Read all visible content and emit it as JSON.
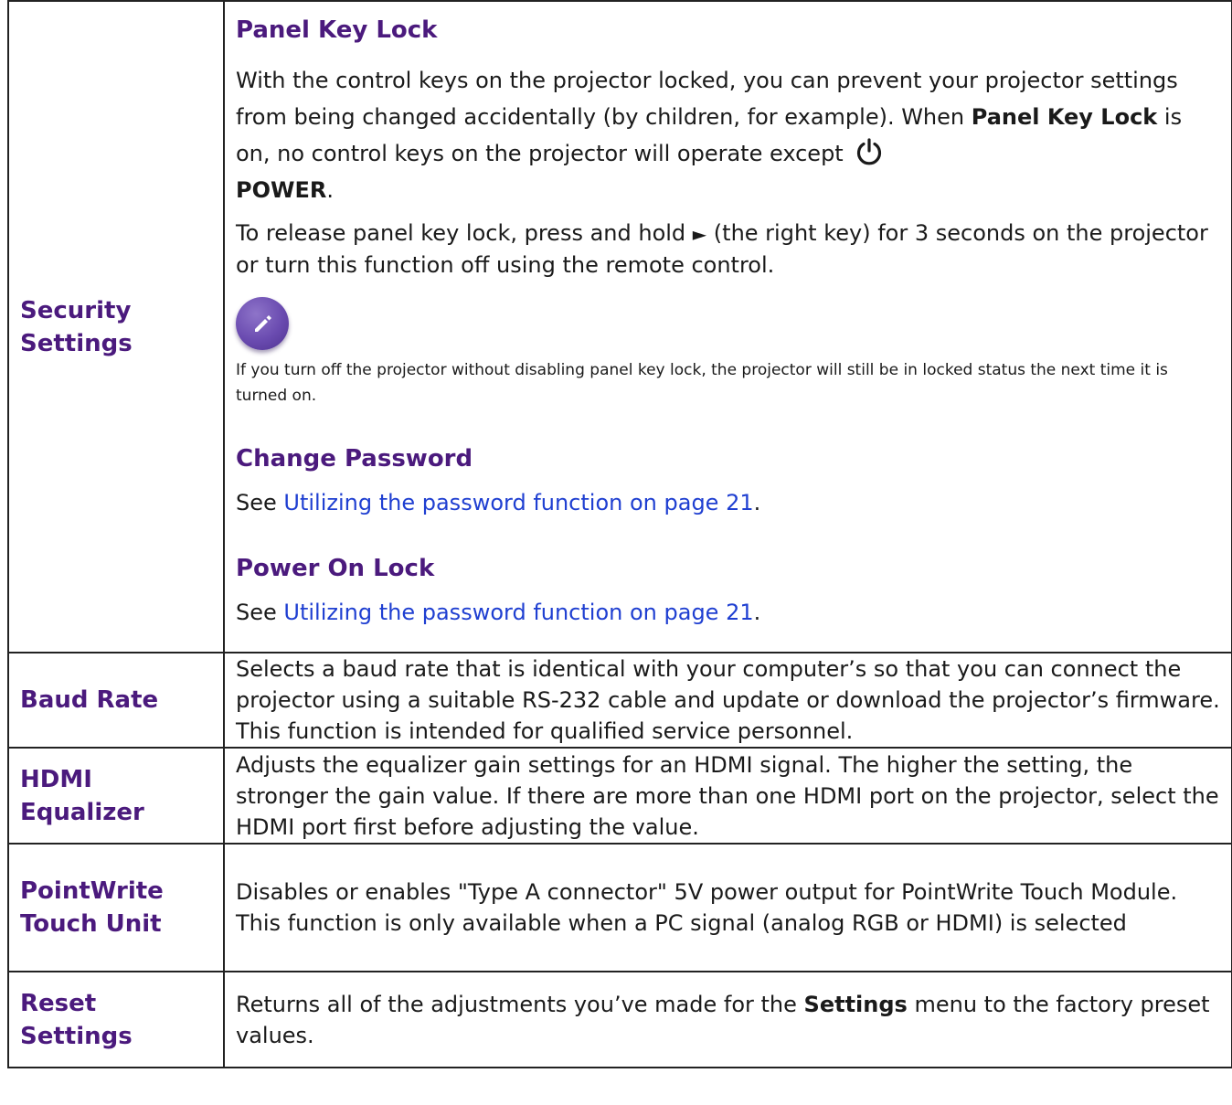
{
  "security": {
    "label_line1": "Security",
    "label_line2": "Settings",
    "panel_key_lock": {
      "heading": "Panel Key Lock",
      "para1_a": "With the control keys on the projector locked, you can prevent your projector settings from being changed accidentally (by children, for example). When ",
      "para1_b": "Panel Key Lock",
      "para1_c": " is on, no control keys on the projector will operate except ",
      "para1_d": "POWER",
      "para1_e": ".",
      "para2_a": "To release panel key lock, press and hold ",
      "para2_arrow": "►",
      "para2_b": " (the right key) for 3 seconds on the projector or turn this function off using the remote control.",
      "note": "If you turn off the projector without disabling panel key lock, the projector will still be in locked status the next time it is turned on.",
      "note_icon": "pencil-note-icon",
      "power_icon": "power-icon"
    },
    "change_password": {
      "heading": "Change Password",
      "see": "See ",
      "link": "Utilizing the password function on page 21",
      "end": "."
    },
    "power_on_lock": {
      "heading": "Power On Lock",
      "see": "See ",
      "link": "Utilizing the password function on page 21",
      "end": "."
    }
  },
  "baud_rate": {
    "label": "Baud Rate",
    "desc": "Selects a baud rate that is identical with your computer’s so that you can connect the projector using a suitable RS-232 cable and update or download the projector’s firmware. This function is intended for qualified service personnel."
  },
  "hdmi_equalizer": {
    "label_line1": "HDMI",
    "label_line2": "Equalizer",
    "desc": "Adjusts the equalizer gain settings for an HDMI signal. The higher the setting, the stronger the gain value. If there are more than one HDMI port on the projector, select the HDMI port first before adjusting the value."
  },
  "pointwrite": {
    "label_line1": "PointWrite",
    "label_line2": "Touch Unit",
    "desc": "Disables or enables \"Type A connector\" 5V power output for PointWrite Touch Module. This function is only available when a PC signal (analog RGB or HDMI) is selected"
  },
  "reset": {
    "label": "Reset Settings",
    "desc_a": "Returns all of the adjustments you’ve made for the ",
    "desc_b": "Settings",
    "desc_c": " menu to the factory preset values."
  },
  "colors": {
    "heading": "#4b1a7d",
    "link": "#1f3fd1",
    "note_icon": "#6a4bb0",
    "border": "#222222"
  }
}
